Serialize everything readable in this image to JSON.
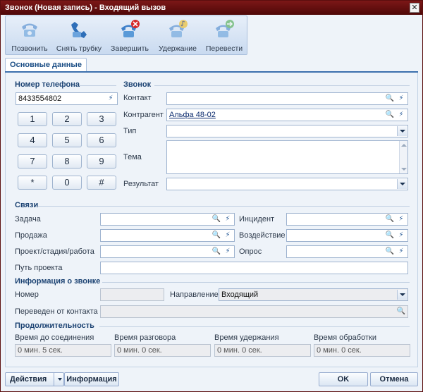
{
  "window": {
    "title": "Звонок (Новая запись) - Входящий вызов"
  },
  "toolbar": {
    "call_label": "Позвонить",
    "pickup_label": "Снять трубку",
    "end_label": "Завершить",
    "hold_label": "Удержание",
    "transfer_label": "Перевести"
  },
  "tabs": {
    "main": "Основные данные"
  },
  "phone": {
    "group": "Номер телефона",
    "number": "8433554802",
    "keys": [
      "1",
      "2",
      "3",
      "4",
      "5",
      "6",
      "7",
      "8",
      "9",
      "*",
      "0",
      "#"
    ]
  },
  "call": {
    "group": "Звонок",
    "contact_label": "Контакт",
    "contact_value": "",
    "account_label": "Контрагент",
    "account_value": "Альфа 48-02",
    "type_label": "Тип",
    "type_value": "",
    "subject_label": "Тема",
    "subject_value": "",
    "result_label": "Результат",
    "result_value": ""
  },
  "links": {
    "group": "Связи",
    "task_label": "Задача",
    "incident_label": "Инцидент",
    "sale_label": "Продажа",
    "impact_label": "Воздействие",
    "project_label": "Проект/стадия/работа",
    "survey_label": "Опрос",
    "path_label": "Путь проекта"
  },
  "callinfo": {
    "group": "Информация о звонке",
    "number_label": "Номер",
    "number_value": "",
    "direction_label": "Направление",
    "direction_value": "Входящий",
    "transferred_label": "Переведен от контакта",
    "transferred_value": ""
  },
  "duration": {
    "group": "Продолжительность",
    "before_label": "Время до соединения",
    "before_value": "0 мин. 5 сек.",
    "talk_label": "Время разговора",
    "talk_value": "0 мин. 0 сек.",
    "hold_label": "Время удержания",
    "hold_value": "0 мин. 0 сек.",
    "process_label": "Время обработки",
    "process_value": "0 мин. 0 сек."
  },
  "footer": {
    "actions_label": "Действия",
    "info_label": "Информация",
    "ok_label": "OK",
    "cancel_label": "Отмена"
  },
  "icons": {
    "phone_icon": "phone-icon",
    "pickup_icon": "phone-pickup-icon",
    "end_icon": "phone-end-icon",
    "hold_icon": "phone-hold-icon",
    "transfer_icon": "phone-transfer-icon",
    "search_icon": "search-icon",
    "clear_icon": "lightning-icon",
    "close_icon": "close-icon"
  },
  "colors": {
    "title_bg": "#6a1111",
    "accent": "#3c70ad",
    "group_title": "#1c4373"
  }
}
